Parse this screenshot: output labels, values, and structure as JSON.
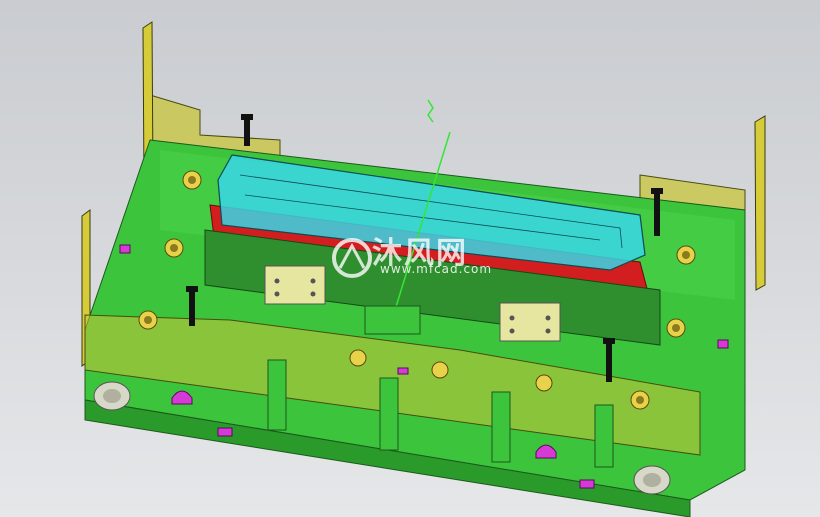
{
  "scene": {
    "description_colors": {
      "background_top": "#c9ccd0",
      "background_bottom": "#e6e7e9",
      "plate_green": "#3cc43c",
      "plate_dark_green": "#2a9a2a",
      "cover_yellow": "#c8c43a",
      "part_cyan": "#38d6e6",
      "part_red": "#d21e1e",
      "magenta": "#d63ad6",
      "brass": "#e8d24a"
    },
    "icons": [
      "bolt-icon",
      "bushing-icon",
      "guide-pin-icon"
    ]
  },
  "watermark": {
    "logo": "mfcad-logo",
    "text": "沐风网",
    "url": "www.mfcad.com"
  }
}
